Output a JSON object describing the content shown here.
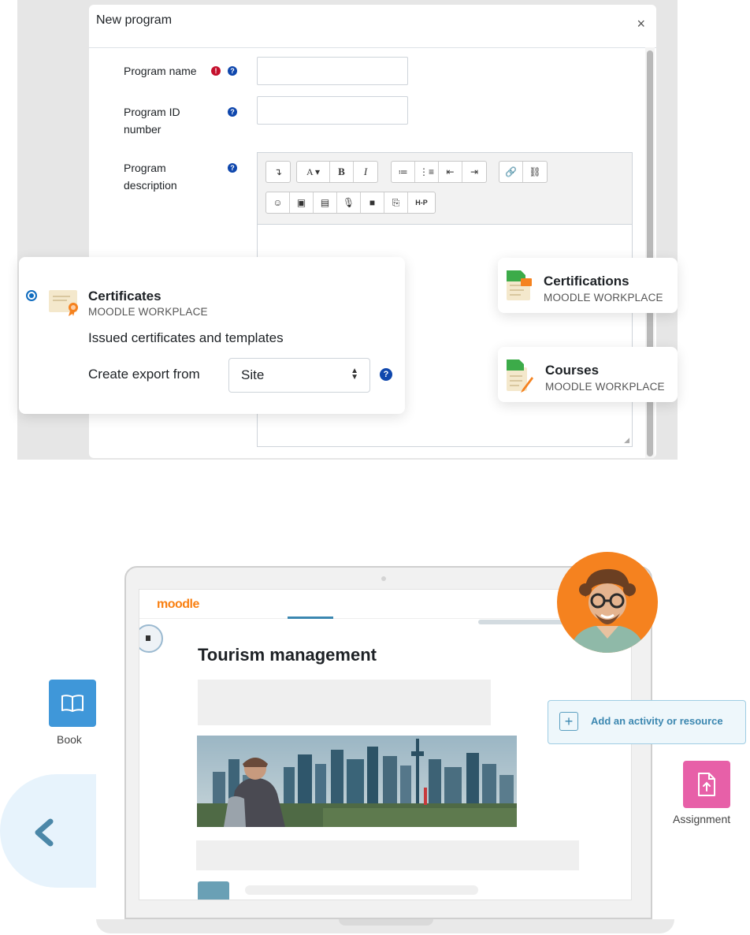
{
  "modal": {
    "title": "New program",
    "close": "×",
    "fields": {
      "program_name": "Program name",
      "program_id": "Program ID\nnumber",
      "program_description": "Program\ndescription"
    },
    "toolbar": {
      "row1": [
        "↴",
        "A ▾",
        "B",
        "I",
        "≔",
        "⋮≡",
        "⇤",
        "⇥",
        "🔗",
        "⛓"
      ],
      "row2": [
        "☺",
        "▣",
        "▤",
        "🎙",
        "■",
        "⎘",
        "H-P"
      ]
    }
  },
  "certificates_card": {
    "title": "Certificates",
    "subtitle": "MOODLE WORKPLACE",
    "description": "Issued certificates and templates",
    "export_label": "Create export from",
    "export_value": "Site"
  },
  "certifications_card": {
    "title": "Certifications",
    "subtitle": "MOODLE WORKPLACE"
  },
  "courses_card": {
    "title": "Courses",
    "subtitle": "MOODLE WORKPLACE"
  },
  "laptop": {
    "logo": "moodle",
    "course_title": "Tourism management"
  },
  "add_activity": {
    "label": "Add an activity or resource",
    "plus": "+"
  },
  "tiles": {
    "book_label": "Book",
    "assignment_label": "Assignment"
  },
  "colors": {
    "moodle_orange": "#f98012",
    "help_blue": "#0f47ad",
    "required_red": "#c5102d",
    "book_tile": "#3f97d9",
    "assignment_tile": "#e760a8",
    "avatar_bg": "#f5821f"
  }
}
